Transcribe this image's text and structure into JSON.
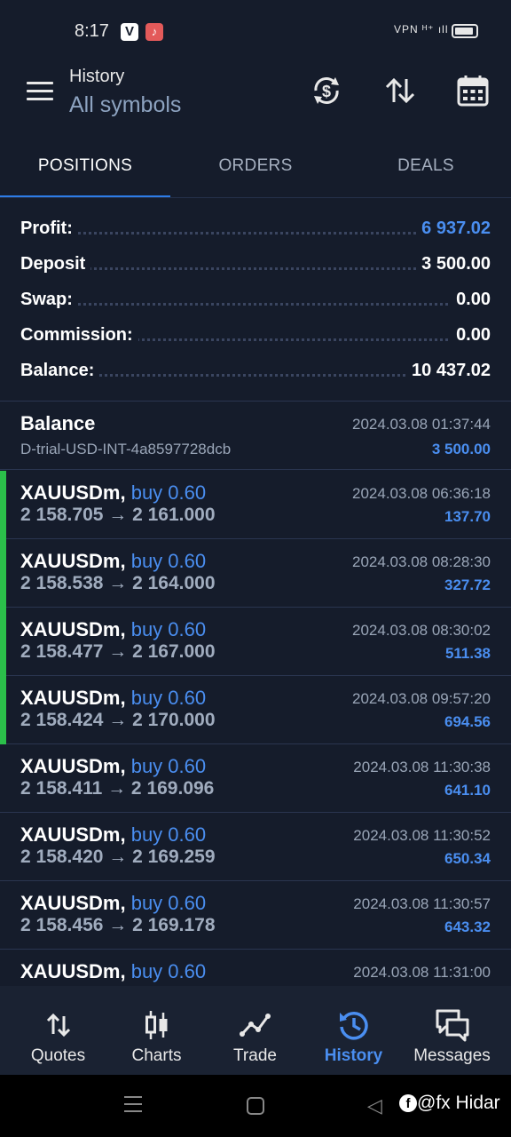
{
  "status_bar": {
    "time": "8:17",
    "app1": "V",
    "app2": "♪",
    "signal": "VPN ᴴ⁺ ıll"
  },
  "header": {
    "title": "History",
    "subtitle": "All symbols"
  },
  "tabs": [
    {
      "label": "POSITIONS",
      "active": true
    },
    {
      "label": "ORDERS",
      "active": false
    },
    {
      "label": "DEALS",
      "active": false
    }
  ],
  "summary": {
    "profit": {
      "label": "Profit:",
      "value": "6 937.02"
    },
    "deposit": {
      "label": "Deposit",
      "value": "3 500.00"
    },
    "swap": {
      "label": "Swap:",
      "value": "0.00"
    },
    "commission": {
      "label": "Commission:",
      "value": "0.00"
    },
    "balance": {
      "label": "Balance:",
      "value": "10 437.02"
    }
  },
  "balance_entry": {
    "title": "Balance",
    "description": "D-trial-USD-INT-4a8597728dcb",
    "time": "2024.03.08 01:37:44",
    "amount": "3 500.00"
  },
  "deals": [
    {
      "symbol": "XAUUSDm,",
      "type": "buy 0.60",
      "prices": "2 158.705 → 2 161.000",
      "time": "2024.03.08 06:36:18",
      "profit": "137.70",
      "highlight": true
    },
    {
      "symbol": "XAUUSDm,",
      "type": "buy 0.60",
      "prices": "2 158.538 → 2 164.000",
      "time": "2024.03.08 08:28:30",
      "profit": "327.72",
      "highlight": true
    },
    {
      "symbol": "XAUUSDm,",
      "type": "buy 0.60",
      "prices": "2 158.477 → 2 167.000",
      "time": "2024.03.08 08:30:02",
      "profit": "511.38",
      "highlight": true
    },
    {
      "symbol": "XAUUSDm,",
      "type": "buy 0.60",
      "prices": "2 158.424 → 2 170.000",
      "time": "2024.03.08 09:57:20",
      "profit": "694.56",
      "highlight": true
    },
    {
      "symbol": "XAUUSDm,",
      "type": "buy 0.60",
      "prices": "2 158.411 → 2 169.096",
      "time": "2024.03.08 11:30:38",
      "profit": "641.10",
      "highlight": false
    },
    {
      "symbol": "XAUUSDm,",
      "type": "buy 0.60",
      "prices": "2 158.420 → 2 169.259",
      "time": "2024.03.08 11:30:52",
      "profit": "650.34",
      "highlight": false
    },
    {
      "symbol": "XAUUSDm,",
      "type": "buy 0.60",
      "prices": "2 158.456 → 2 169.178",
      "time": "2024.03.08 11:30:57",
      "profit": "643.32",
      "highlight": false
    },
    {
      "symbol": "XAUUSDm,",
      "type": "buy 0.60",
      "prices": "",
      "time": "2024.03.08 11:31:00",
      "profit": "",
      "highlight": false
    }
  ],
  "bottom_nav": [
    {
      "label": "Quotes",
      "icon": "quotes-icon",
      "active": false
    },
    {
      "label": "Charts",
      "icon": "charts-icon",
      "active": false
    },
    {
      "label": "Trade",
      "icon": "trade-icon",
      "active": false
    },
    {
      "label": "History",
      "icon": "history-icon",
      "active": true
    },
    {
      "label": "Messages",
      "icon": "messages-icon",
      "active": false
    }
  ],
  "watermark": {
    "fb": "f",
    "text": "@fx Hidar"
  },
  "colors": {
    "background": "#151c2b",
    "accent": "#4a8ef0",
    "profit_bar": "#2bbf4a"
  }
}
